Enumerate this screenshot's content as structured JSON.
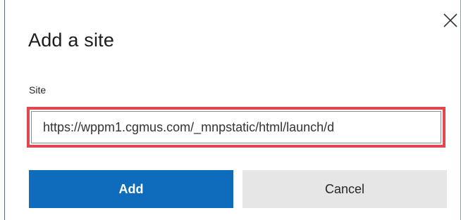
{
  "dialog": {
    "title": "Add a site",
    "close_icon": "close-icon",
    "site_field": {
      "label": "Site",
      "value": "https://wppm1.cgmus.com/_mnpstatic/html/launch/d",
      "highlight_color": "#e2474f"
    },
    "buttons": {
      "add_label": "Add",
      "cancel_label": "Cancel"
    },
    "colors": {
      "primary": "#0f6cbd",
      "secondary": "#e6e6e6"
    }
  }
}
